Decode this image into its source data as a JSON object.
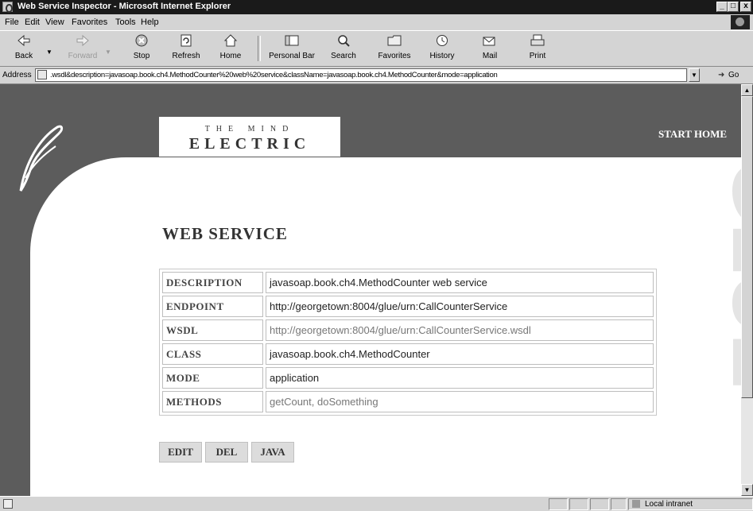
{
  "window": {
    "title": "Web Service Inspector - Microsoft Internet Explorer",
    "controls": {
      "minimize": "_",
      "maximize": "□",
      "close": "x"
    }
  },
  "menu": [
    "File",
    "Edit",
    "View",
    "Favorites",
    "Tools",
    "Help"
  ],
  "toolbar": {
    "back": "Back",
    "forward": "Forward",
    "stop": "Stop",
    "refresh": "Refresh",
    "home": "Home",
    "personal_bar": "Personal Bar",
    "search": "Search",
    "favorites": "Favorites",
    "history": "History",
    "mail": "Mail",
    "print": "Print"
  },
  "address": {
    "label": "Address",
    "value": ".wsdl&description=javasoap.book.ch4.MethodCounter%20web%20service&className=javasoap.book.ch4.MethodCounter&mode=application",
    "go": "Go"
  },
  "page": {
    "logo_top": "THE MIND",
    "logo_bottom": "ELECTRIC",
    "nav_link": "START HOME",
    "side_logo": "GLUE",
    "heading": "WEB SERVICE",
    "rows": [
      {
        "label": "DESCRIPTION",
        "value": "javasoap.book.ch4.MethodCounter web service"
      },
      {
        "label": "ENDPOINT",
        "value": "http://georgetown:8004/glue/urn:CallCounterService"
      },
      {
        "label": "WSDL",
        "value": "http://georgetown:8004/glue/urn:CallCounterService.wsdl"
      },
      {
        "label": "CLASS",
        "value": "javasoap.book.ch4.MethodCounter"
      },
      {
        "label": "MODE",
        "value": "application"
      },
      {
        "label": "METHODS",
        "value": "getCount, doSomething"
      }
    ],
    "buttons": {
      "edit": "EDIT",
      "del": "DEL",
      "java": "JAVA"
    }
  },
  "status": {
    "zone": "Local intranet"
  },
  "colors": {
    "header_gray": "#5c5c5c",
    "title_bar": "#1a1a1a",
    "panel": "#ffffff"
  }
}
